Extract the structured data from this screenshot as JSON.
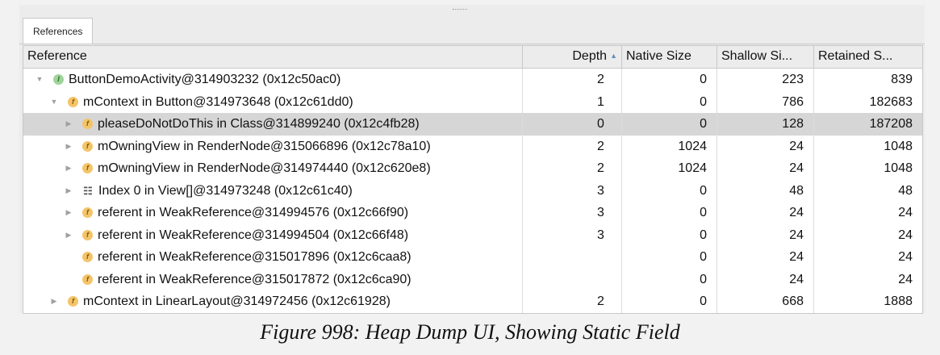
{
  "tabs": [
    {
      "label": "References"
    }
  ],
  "columns": [
    {
      "label": "Reference"
    },
    {
      "label": "Depth",
      "sort_icon": "sort-ascending-icon"
    },
    {
      "label": "Native Size"
    },
    {
      "label": "Shallow Si..."
    },
    {
      "label": "Retained S..."
    }
  ],
  "rows": [
    {
      "toggle": "expanded",
      "icon": "instance-icon",
      "badge": "I",
      "name": "ButtonDemoActivity@314903232 (0x12c50ac0)",
      "depth": "2",
      "native_size": "0",
      "shallow_size": "223",
      "retained_size": "839"
    },
    {
      "toggle": "expanded",
      "icon": "field-icon",
      "badge": "f",
      "name": "mContext in Button@314973648 (0x12c61dd0)",
      "depth": "1",
      "native_size": "0",
      "shallow_size": "786",
      "retained_size": "182683"
    },
    {
      "toggle": "collapsed",
      "icon": "field-icon",
      "badge": "f",
      "name": "pleaseDoNotDoThis in Class@314899240 (0x12c4fb28)",
      "depth": "0",
      "native_size": "0",
      "shallow_size": "128",
      "retained_size": "187208",
      "selected": true
    },
    {
      "toggle": "collapsed",
      "icon": "field-icon",
      "badge": "f",
      "name": "mOwningView in RenderNode@315066896 (0x12c78a10)",
      "depth": "2",
      "native_size": "1024",
      "shallow_size": "24",
      "retained_size": "1048"
    },
    {
      "toggle": "collapsed",
      "icon": "field-icon",
      "badge": "f",
      "name": "mOwningView in RenderNode@314974440 (0x12c620e8)",
      "depth": "2",
      "native_size": "1024",
      "shallow_size": "24",
      "retained_size": "1048"
    },
    {
      "toggle": "collapsed",
      "icon": "array-icon",
      "badge": "☷",
      "name": "Index 0 in View[]@314973248 (0x12c61c40)",
      "depth": "3",
      "native_size": "0",
      "shallow_size": "48",
      "retained_size": "48"
    },
    {
      "toggle": "collapsed",
      "icon": "field-icon",
      "badge": "f",
      "name": "referent in WeakReference@314994576 (0x12c66f90)",
      "depth": "3",
      "native_size": "0",
      "shallow_size": "24",
      "retained_size": "24"
    },
    {
      "toggle": "collapsed",
      "icon": "field-icon",
      "badge": "f",
      "name": "referent in WeakReference@314994504 (0x12c66f48)",
      "depth": "3",
      "native_size": "0",
      "shallow_size": "24",
      "retained_size": "24"
    },
    {
      "toggle": "none",
      "icon": "field-icon",
      "badge": "f",
      "name": "referent in WeakReference@315017896 (0x12c6caa8)",
      "depth": "",
      "native_size": "0",
      "shallow_size": "24",
      "retained_size": "24"
    },
    {
      "toggle": "none",
      "icon": "field-icon",
      "badge": "f",
      "name": "referent in WeakReference@315017872 (0x12c6ca90)",
      "depth": "",
      "native_size": "0",
      "shallow_size": "24",
      "retained_size": "24"
    },
    {
      "toggle": "collapsed",
      "icon": "field-icon",
      "badge": "f",
      "name": "mContext in LinearLayout@314972456 (0x12c61928)",
      "depth": "2",
      "native_size": "0",
      "shallow_size": "668",
      "retained_size": "1888"
    }
  ],
  "caption": "Figure 998: Heap Dump UI, Showing Static Field",
  "colors": {
    "selected_row": "#d6d6d6",
    "field_icon": "#f4c46a",
    "instance_icon": "#9fd39a"
  }
}
